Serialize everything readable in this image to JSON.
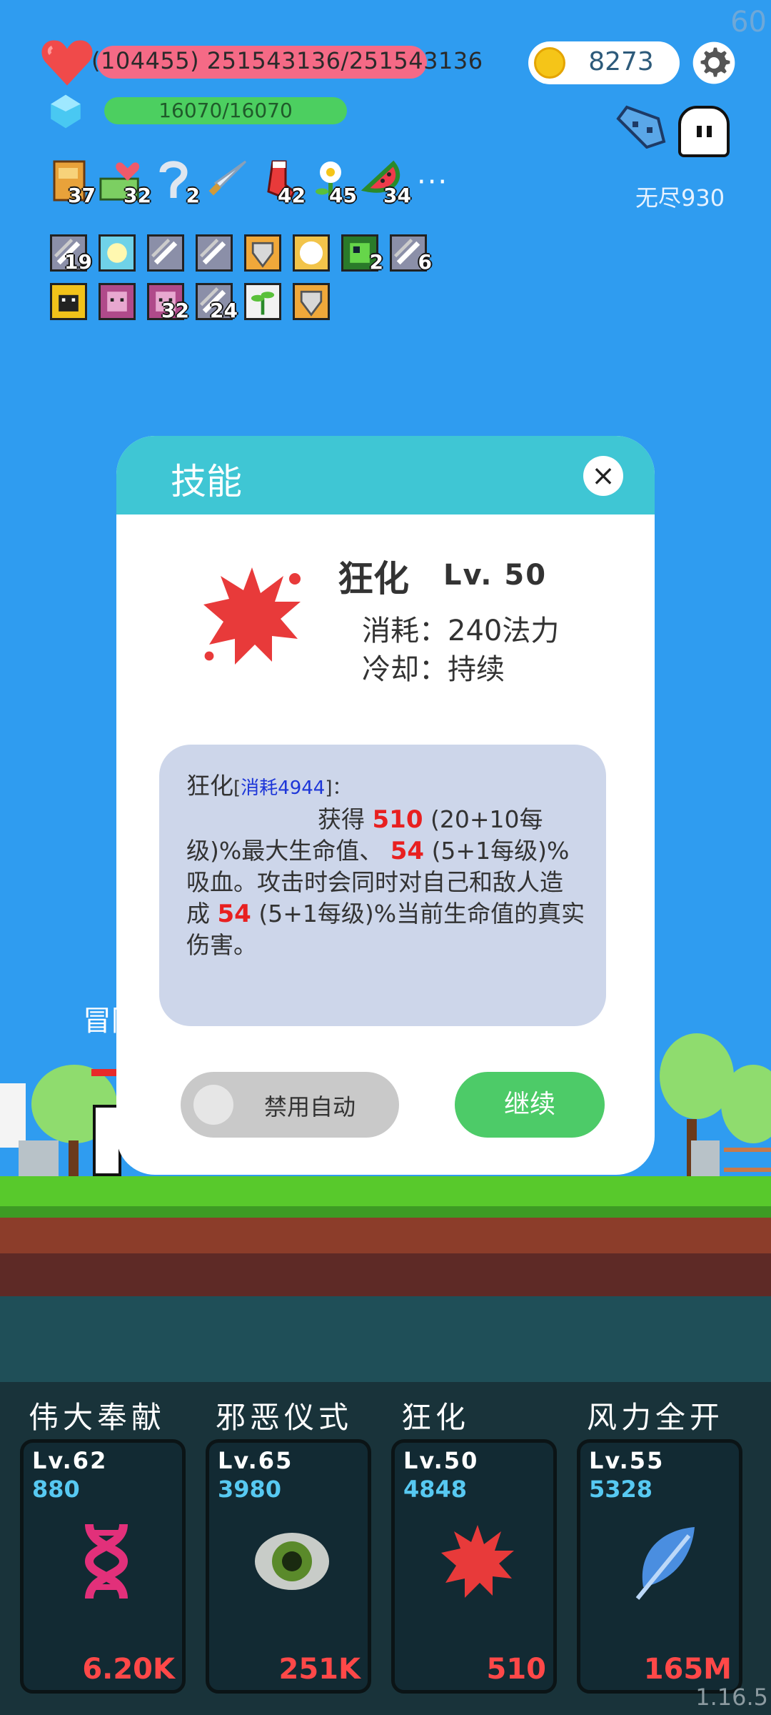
{
  "hud": {
    "fps": "60",
    "hp_text": "(104455) 251543136/251543136",
    "mp_text": "16070/16070",
    "coins": "8273",
    "endless_label": "无尽930"
  },
  "inventory": [
    {
      "icon": "book-icon",
      "count": "37"
    },
    {
      "icon": "heart-money-icon",
      "count": "32"
    },
    {
      "icon": "hook-icon",
      "count": "2"
    },
    {
      "icon": "sword-icon",
      "count": ""
    },
    {
      "icon": "sock-icon",
      "count": "42"
    },
    {
      "icon": "flower-icon",
      "count": "45"
    },
    {
      "icon": "watermelon-icon",
      "count": "34"
    }
  ],
  "inventory_more": "···",
  "buffs_row1": [
    {
      "icon": "slash-icon",
      "count": "19"
    },
    {
      "icon": "light-icon",
      "count": ""
    },
    {
      "icon": "slash-icon",
      "count": ""
    },
    {
      "icon": "slash-icon",
      "count": ""
    },
    {
      "icon": "shield-icon",
      "count": ""
    },
    {
      "icon": "burst-icon",
      "count": ""
    },
    {
      "icon": "circuit-icon",
      "count": "2"
    },
    {
      "icon": "slash-icon",
      "count": "6"
    }
  ],
  "buffs_row2": [
    {
      "icon": "monster-icon",
      "count": ""
    },
    {
      "icon": "demon-icon",
      "count": ""
    },
    {
      "icon": "demon-icon",
      "count": "32"
    },
    {
      "icon": "slash-icon",
      "count": "24"
    },
    {
      "icon": "sprout-icon",
      "count": ""
    },
    {
      "icon": "shield-icon",
      "count": ""
    }
  ],
  "scene": {
    "adventure_label": "冒险"
  },
  "modal": {
    "title": "技能",
    "close": "×",
    "skill_name": "狂化",
    "skill_level": "Lv. 50",
    "cost": "消耗：240法力",
    "cooldown": "冷却：持续",
    "desc_name": "狂化",
    "desc_tag_open": "[",
    "desc_tag": "消耗4944",
    "desc_tag_close": "]：",
    "desc_gain": "获得",
    "val1": "510",
    "text1": "(20+10每级)%最大生命值、",
    "val2": "54",
    "text2": "(5+1每级)%吸血。攻击时会同时对自己和敌人造成",
    "val3": "54",
    "text3": "(5+1每级)%当前生命值的真实伤害。",
    "toggle_label": "禁用自动",
    "continue_label": "继续"
  },
  "skills": [
    {
      "name": "伟大奉献",
      "level": "Lv.62",
      "cost": "880",
      "value": "6.20K",
      "icon": "dna-icon"
    },
    {
      "name": "邪恶仪式",
      "level": "Lv.65",
      "cost": "3980",
      "value": "251K",
      "icon": "eye-icon"
    },
    {
      "name": "狂化",
      "level": "Lv.50",
      "cost": "4848",
      "value": "510",
      "icon": "splat-icon"
    },
    {
      "name": "风力全开",
      "level": "Lv.55",
      "cost": "5328",
      "value": "165M",
      "icon": "feather-icon"
    }
  ],
  "version": "1.16.5",
  "colors": {
    "sky": "#2f9cf0",
    "hp": "#f56a86",
    "mp": "#4ccf60",
    "accent": "#3fc6d4",
    "continue": "#4dcb68",
    "damage": "#ff4848",
    "cost": "#57c9f2"
  }
}
